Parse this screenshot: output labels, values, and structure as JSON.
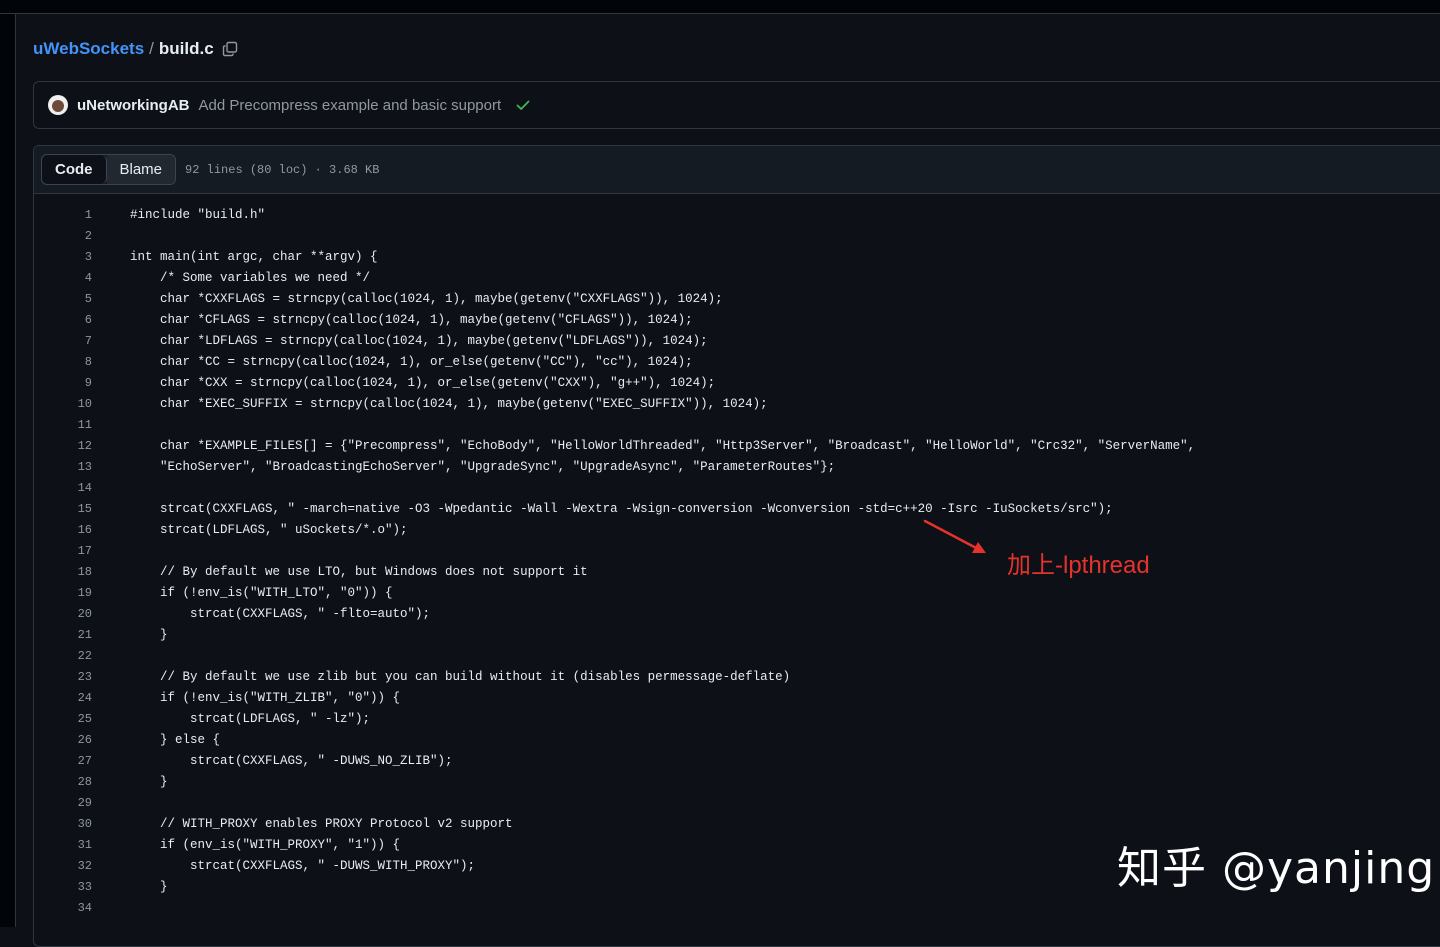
{
  "breadcrumb": {
    "repo": "uWebSockets",
    "separator": "/",
    "file": "build.c",
    "copy_icon": "copy-icon"
  },
  "commit": {
    "author": "uNetworkingAB",
    "message": "Add Precompress example and basic support",
    "status_icon": "check-icon",
    "status_color": "#3fb950"
  },
  "file_header": {
    "tabs": [
      {
        "label": "Code",
        "active": true
      },
      {
        "label": "Blame",
        "active": false
      }
    ],
    "info": "92 lines (80 loc) · 3.68 KB"
  },
  "code_lines": [
    {
      "n": "1",
      "text": "#include \"build.h\""
    },
    {
      "n": "2",
      "text": ""
    },
    {
      "n": "3",
      "text": "int main(int argc, char **argv) {"
    },
    {
      "n": "4",
      "text": "    /* Some variables we need */"
    },
    {
      "n": "5",
      "text": "    char *CXXFLAGS = strncpy(calloc(1024, 1), maybe(getenv(\"CXXFLAGS\")), 1024);"
    },
    {
      "n": "6",
      "text": "    char *CFLAGS = strncpy(calloc(1024, 1), maybe(getenv(\"CFLAGS\")), 1024);"
    },
    {
      "n": "7",
      "text": "    char *LDFLAGS = strncpy(calloc(1024, 1), maybe(getenv(\"LDFLAGS\")), 1024);"
    },
    {
      "n": "8",
      "text": "    char *CC = strncpy(calloc(1024, 1), or_else(getenv(\"CC\"), \"cc\"), 1024);"
    },
    {
      "n": "9",
      "text": "    char *CXX = strncpy(calloc(1024, 1), or_else(getenv(\"CXX\"), \"g++\"), 1024);"
    },
    {
      "n": "10",
      "text": "    char *EXEC_SUFFIX = strncpy(calloc(1024, 1), maybe(getenv(\"EXEC_SUFFIX\")), 1024);"
    },
    {
      "n": "11",
      "text": ""
    },
    {
      "n": "12",
      "text": "    char *EXAMPLE_FILES[] = {\"Precompress\", \"EchoBody\", \"HelloWorldThreaded\", \"Http3Server\", \"Broadcast\", \"HelloWorld\", \"Crc32\", \"ServerName\","
    },
    {
      "n": "13",
      "text": "    \"EchoServer\", \"BroadcastingEchoServer\", \"UpgradeSync\", \"UpgradeAsync\", \"ParameterRoutes\"};"
    },
    {
      "n": "14",
      "text": ""
    },
    {
      "n": "15",
      "text": "    strcat(CXXFLAGS, \" -march=native -O3 -Wpedantic -Wall -Wextra -Wsign-conversion -Wconversion -std=c++20 -Isrc -IuSockets/src\");"
    },
    {
      "n": "16",
      "text": "    strcat(LDFLAGS, \" uSockets/*.o\");"
    },
    {
      "n": "17",
      "text": ""
    },
    {
      "n": "18",
      "text": "    // By default we use LTO, but Windows does not support it"
    },
    {
      "n": "19",
      "text": "    if (!env_is(\"WITH_LTO\", \"0\")) {"
    },
    {
      "n": "20",
      "text": "        strcat(CXXFLAGS, \" -flto=auto\");"
    },
    {
      "n": "21",
      "text": "    }"
    },
    {
      "n": "22",
      "text": ""
    },
    {
      "n": "23",
      "text": "    // By default we use zlib but you can build without it (disables permessage-deflate)"
    },
    {
      "n": "24",
      "text": "    if (!env_is(\"WITH_ZLIB\", \"0\")) {"
    },
    {
      "n": "25",
      "text": "        strcat(LDFLAGS, \" -lz\");"
    },
    {
      "n": "26",
      "text": "    } else {"
    },
    {
      "n": "27",
      "text": "        strcat(CXXFLAGS, \" -DUWS_NO_ZLIB\");"
    },
    {
      "n": "28",
      "text": "    }"
    },
    {
      "n": "29",
      "text": ""
    },
    {
      "n": "30",
      "text": "    // WITH_PROXY enables PROXY Protocol v2 support"
    },
    {
      "n": "31",
      "text": "    if (env_is(\"WITH_PROXY\", \"1\")) {"
    },
    {
      "n": "32",
      "text": "        strcat(CXXFLAGS, \" -DUWS_WITH_PROXY\");"
    },
    {
      "n": "33",
      "text": "    }"
    },
    {
      "n": "34",
      "text": ""
    }
  ],
  "annotation": {
    "text": "加上-lpthread",
    "color": "#e5322d"
  },
  "watermark": {
    "text": "知乎 @yanjing"
  }
}
